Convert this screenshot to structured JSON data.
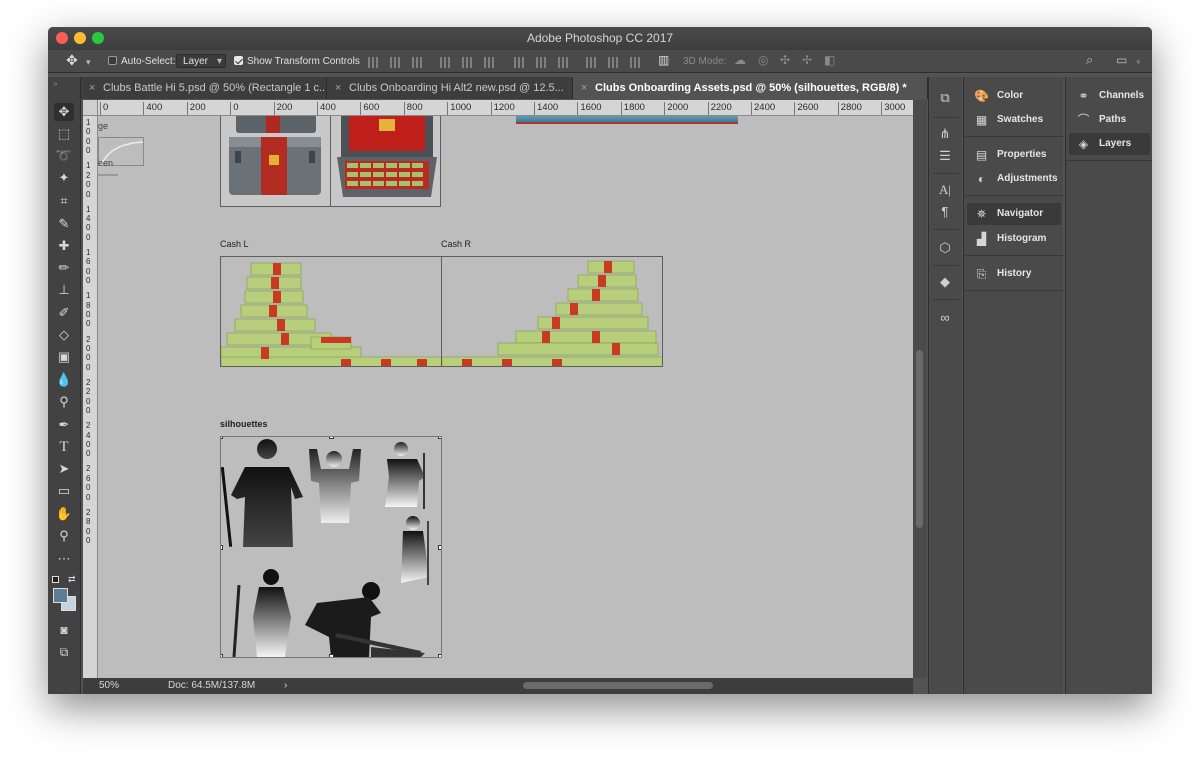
{
  "window": {
    "title": "Adobe Photoshop CC 2017",
    "traffic_colors": [
      "#fc5f57",
      "#fdbc2e",
      "#28c840"
    ]
  },
  "options_bar": {
    "auto_select_label": "Auto-Select:",
    "auto_select_checked": false,
    "layer_select_value": "Layer",
    "show_transform_label": "Show Transform Controls",
    "show_transform_checked": true,
    "mode_3d_label": "3D Mode:"
  },
  "tabs": [
    {
      "label": "Clubs Battle Hi 5.psd @ 50% (Rectangle 1 c...",
      "active": false
    },
    {
      "label": "Clubs Onboarding Hi Alt2 new.psd @ 12.5...",
      "active": false
    },
    {
      "label": "Clubs Onboarding Assets.psd @ 50% (silhouettes, RGB/8) *",
      "active": true
    }
  ],
  "ruler_top_labels": [
    "0",
    "400",
    "200",
    "0",
    "200",
    "400",
    "600",
    "800",
    "1000",
    "1200",
    "1400",
    "1600",
    "1800",
    "2000",
    "2200",
    "2400",
    "2600",
    "2800",
    "3000"
  ],
  "ruler_left_labels": [
    "1",
    "0",
    "0",
    "0",
    "1",
    "2",
    "0",
    "0",
    "1",
    "4",
    "0",
    "0",
    "1",
    "6",
    "0",
    "0",
    "1",
    "8",
    "0",
    "0",
    "2",
    "0",
    "0",
    "0",
    "2",
    "2",
    "0",
    "0",
    "2",
    "4",
    "0",
    "0",
    "2",
    "6",
    "0",
    "0",
    "2",
    "8",
    "0",
    "0"
  ],
  "canvas": {
    "partial_text_top": "ge",
    "partial_text_mid": "een",
    "cash_l_label": "Cash L",
    "cash_r_label": "Cash R",
    "silhouettes_label": "silhouettes"
  },
  "status": {
    "zoom": "50%",
    "doc": "Doc: 64.5M/137.8M",
    "arrow": "›"
  },
  "panels_middle": [
    {
      "label": "Color",
      "icon": "palette-icon"
    },
    {
      "label": "Swatches",
      "icon": "grid-icon"
    },
    {
      "label": "Properties",
      "icon": "properties-icon"
    },
    {
      "label": "Adjustments",
      "icon": "adjustments-icon"
    },
    {
      "label": "Navigator",
      "icon": "navigator-icon"
    },
    {
      "label": "Histogram",
      "icon": "histogram-icon"
    },
    {
      "label": "History",
      "icon": "history-icon"
    }
  ],
  "panels_right": [
    {
      "label": "Channels",
      "icon": "channels-icon"
    },
    {
      "label": "Paths",
      "icon": "paths-icon"
    },
    {
      "label": "Layers",
      "icon": "layers-icon"
    }
  ],
  "colors": {
    "foreground_swatch": "#5d7d97",
    "background_swatch": "#c3d3df",
    "canvas_bg": "#bdbdbd"
  }
}
